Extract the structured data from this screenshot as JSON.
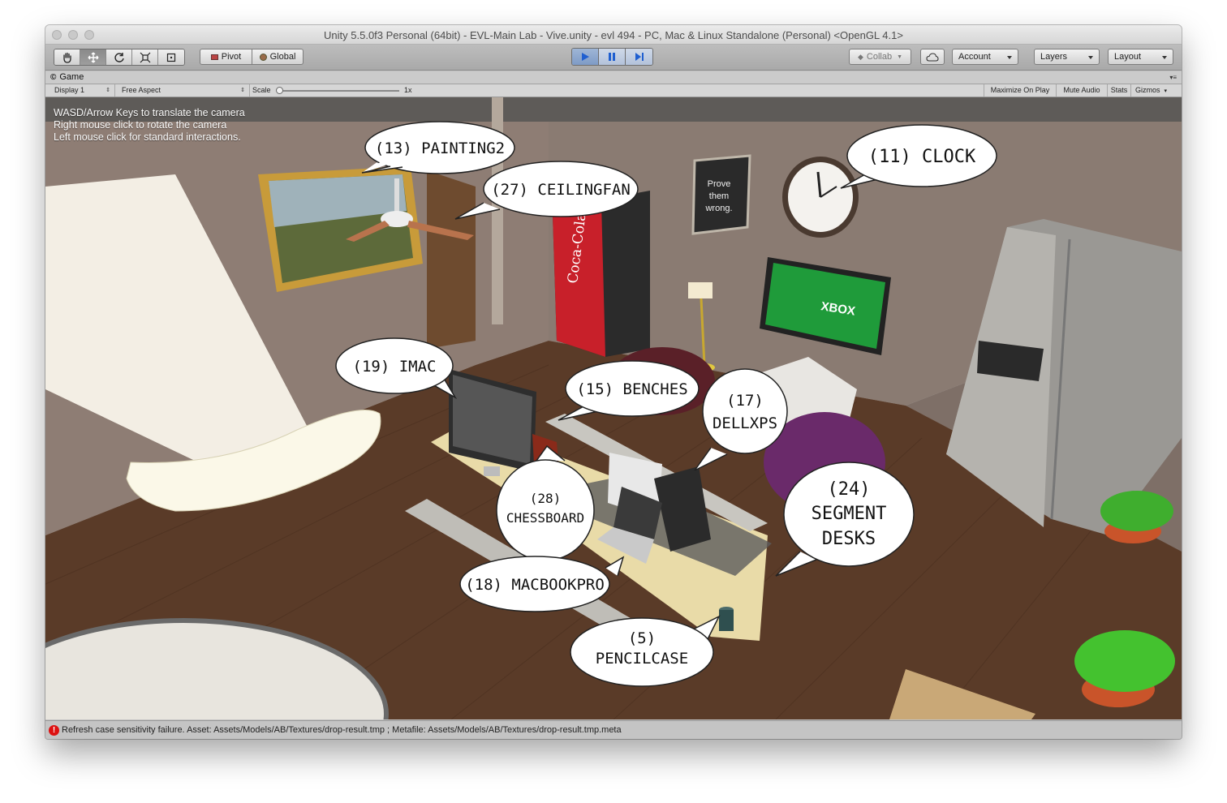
{
  "window": {
    "title": "Unity 5.5.0f3 Personal (64bit) - EVL-Main Lab - Vive.unity - evl 494 - PC, Mac & Linux Standalone (Personal) <OpenGL 4.1>"
  },
  "toolbar": {
    "tools": [
      "hand-icon",
      "move-icon",
      "rotate-icon",
      "scale-icon",
      "rect-tool-icon"
    ],
    "pivot_label": "Pivot",
    "global_label": "Global",
    "collab_label": "Collab",
    "account_label": "Account",
    "layers_label": "Layers",
    "layout_label": "Layout",
    "play_accent": "#3b78d8"
  },
  "game_view": {
    "tab_label": "Game",
    "display_label": "Display 1",
    "aspect_label": "Free Aspect",
    "scale_label": "Scale",
    "scale_value": "1x",
    "maximize_label": "Maximize On Play",
    "mute_label": "Mute Audio",
    "stats_label": "Stats",
    "gizmos_label": "Gizmos",
    "help_lines": [
      "WASD/Arrow Keys to translate the camera",
      "Right mouse click to rotate the camera",
      "Left mouse click for standard interactions."
    ]
  },
  "scene": {
    "painting_label": "(13) PAINTING2",
    "ceilingfan_label": "(27) CEILINGFAN",
    "clock_label": "(11) CLOCK",
    "imac_label": "(19) IMAC",
    "benches_label": "(15) BENCHES",
    "dellxps_line1": "(17)",
    "dellxps_line2": "DELLXPS",
    "segment_line1": "(24)",
    "segment_line2": "SEGMENT",
    "segment_line3": "DESKS",
    "chessboard_line1": "(28)",
    "chessboard_line2": "CHESSBOARD",
    "macbook_label": "(18) MACBOOKPRO",
    "pencilcase_line1": "(5)",
    "pencilcase_line2": "PENCILCASE",
    "poster_lines": [
      "Prove",
      "them",
      "wrong."
    ],
    "tv_label": "XBOX",
    "vending_label": "Coca-Cola"
  },
  "status": {
    "message": "Refresh case sensitivity failure. Asset: Assets/Models/AB/Textures/drop-result.tmp ; Metafile: Assets/Models/AB/Textures/drop-result.tmp.meta"
  }
}
